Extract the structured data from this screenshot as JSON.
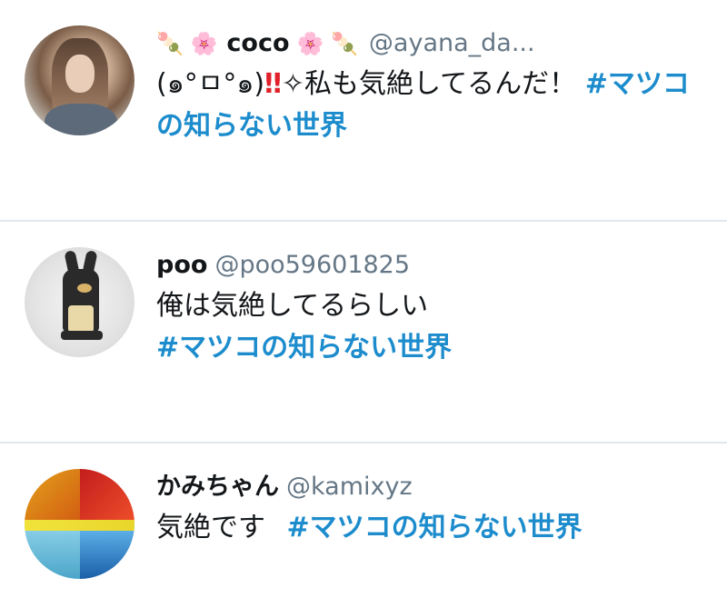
{
  "tweets": [
    {
      "name_prefix_emoji": "🍡 🌸",
      "display_name": "coco",
      "name_suffix_emoji": "🌸 🍡",
      "handle": "@ayana_da...",
      "text_part1": "(๑°ㅁ°๑)",
      "text_bang": "‼",
      "text_part2": "✧私も気絶してるんだ！ ",
      "hashtag": "#マツコの知らない世界",
      "avatar_icon": "user-photo-woman"
    },
    {
      "display_name": "poo",
      "handle": "@poo59601825",
      "text": "俺は気絶してるらしい",
      "hashtag": "#マツコの知らない世界",
      "avatar_icon": "user-photo-figurine"
    },
    {
      "display_name": "かみちゃん",
      "handle": "@kamixyz",
      "text": "気絶です ",
      "hashtag": "#マツコの知らない世界",
      "avatar_icon": "user-photo-collage"
    }
  ],
  "colors": {
    "hashtag": "#1d8ccd",
    "handle": "#657786",
    "divider": "#e1e8ed",
    "text": "#14171a"
  }
}
